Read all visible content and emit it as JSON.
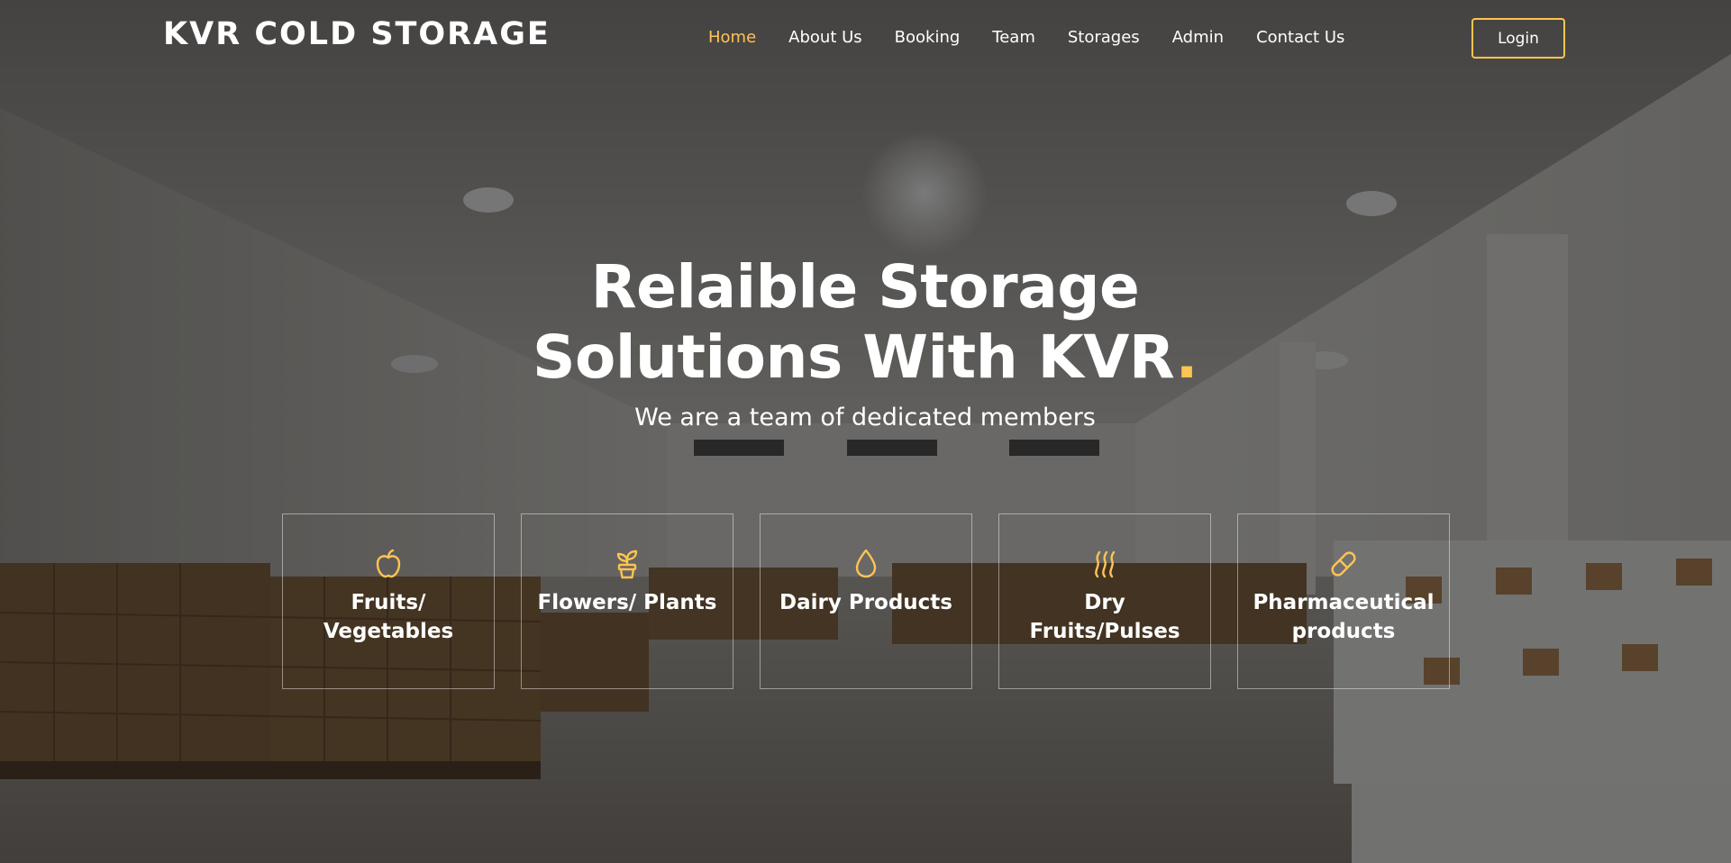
{
  "header": {
    "logo": "KVR COLD STORAGE",
    "nav": [
      {
        "label": "Home",
        "active": true
      },
      {
        "label": "About Us",
        "active": false
      },
      {
        "label": "Booking",
        "active": false
      },
      {
        "label": "Team",
        "active": false
      },
      {
        "label": "Storages",
        "active": false
      },
      {
        "label": "Admin",
        "active": false
      },
      {
        "label": "Contact Us",
        "active": false
      }
    ],
    "login_label": "Login"
  },
  "hero": {
    "title_line1": "Relaible Storage",
    "title_line2": "Solutions With KVR",
    "title_dot": ".",
    "subtitle": "We are a team of dedicated members"
  },
  "categories": [
    {
      "label": "Fruits/ Vegetables",
      "icon": "apple-icon"
    },
    {
      "label": "Flowers/ Plants",
      "icon": "flower-pot-icon"
    },
    {
      "label": "Dairy Products",
      "icon": "droplet-icon"
    },
    {
      "label": "Dry Fruits/Pulses",
      "icon": "heat-waves-icon"
    },
    {
      "label": "Pharmaceutical products",
      "icon": "capsule-icon"
    }
  ],
  "colors": {
    "accent": "#ffc451",
    "text": "#ffffff",
    "overlay": "rgba(0,0,0,0.52)"
  }
}
